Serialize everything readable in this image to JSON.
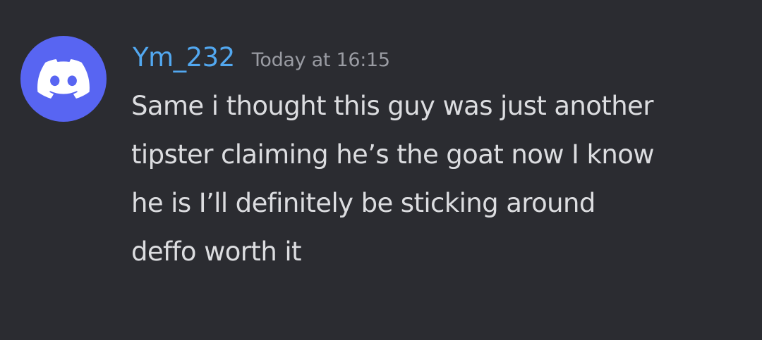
{
  "message": {
    "author": "Ym_232",
    "timestamp": "Today at 16:15",
    "avatar_icon": "discord-logo-icon",
    "text_lines": [
      "Same i thought this guy was just another",
      "tipster claiming he’s the goat now I know",
      "he is I’ll definitely be sticking around",
      "deffo worth it"
    ]
  },
  "colors": {
    "background": "#2b2c31",
    "avatar": "#5865f2",
    "username": "#52a8f0",
    "timestamp": "#9a9ca3",
    "text": "#dcdde0"
  }
}
